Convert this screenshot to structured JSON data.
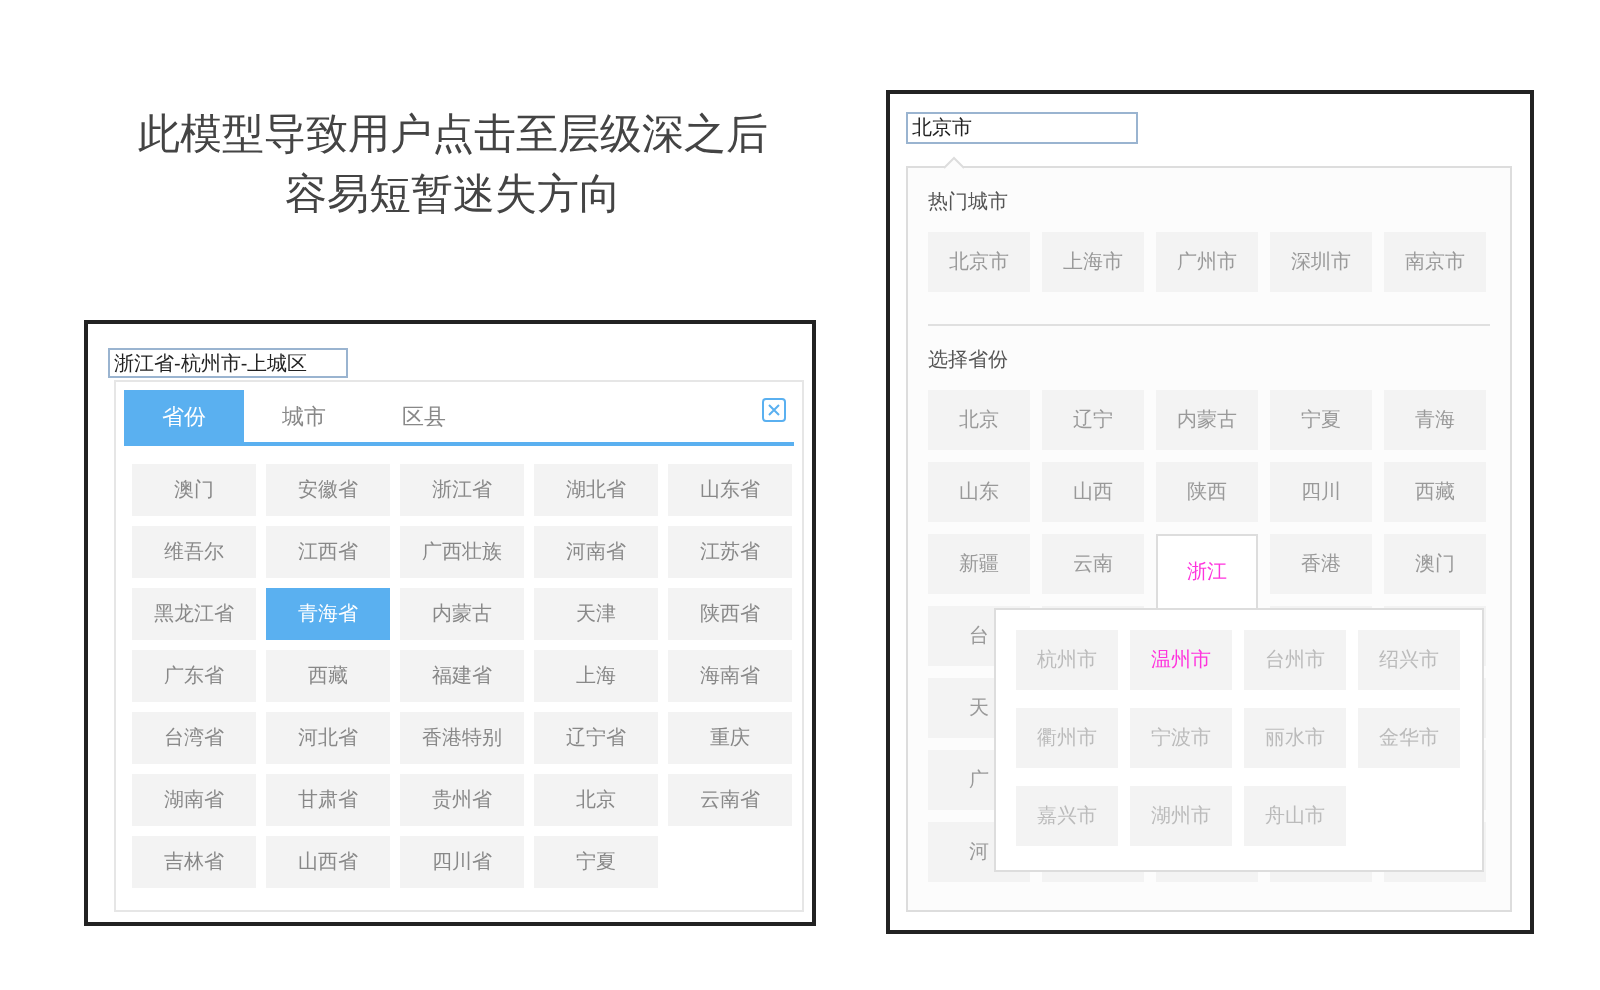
{
  "headline": "此模型导致用户点击至层级深之后容易短暂迷失方向",
  "left_picker": {
    "value": "浙江省-杭州市-上城区",
    "tabs": [
      {
        "label": "省份",
        "selected": true
      },
      {
        "label": "城市",
        "selected": false
      },
      {
        "label": "区县",
        "selected": false
      }
    ],
    "provinces": [
      {
        "label": "澳门",
        "selected": false
      },
      {
        "label": "安徽省",
        "selected": false
      },
      {
        "label": "浙江省",
        "selected": false
      },
      {
        "label": "湖北省",
        "selected": false
      },
      {
        "label": "山东省",
        "selected": false
      },
      {
        "label": "维吾尔",
        "selected": false
      },
      {
        "label": "江西省",
        "selected": false
      },
      {
        "label": "广西壮族",
        "selected": false
      },
      {
        "label": "河南省",
        "selected": false
      },
      {
        "label": "江苏省",
        "selected": false
      },
      {
        "label": "黑龙江省",
        "selected": false
      },
      {
        "label": "青海省",
        "selected": true
      },
      {
        "label": "内蒙古",
        "selected": false
      },
      {
        "label": "天津",
        "selected": false
      },
      {
        "label": "陕西省",
        "selected": false
      },
      {
        "label": "广东省",
        "selected": false
      },
      {
        "label": "西藏",
        "selected": false
      },
      {
        "label": "福建省",
        "selected": false
      },
      {
        "label": "上海",
        "selected": false
      },
      {
        "label": "海南省",
        "selected": false
      },
      {
        "label": "台湾省",
        "selected": false
      },
      {
        "label": "河北省",
        "selected": false
      },
      {
        "label": "香港特别",
        "selected": false
      },
      {
        "label": "辽宁省",
        "selected": false
      },
      {
        "label": "重庆",
        "selected": false
      },
      {
        "label": "湖南省",
        "selected": false
      },
      {
        "label": "甘肃省",
        "selected": false
      },
      {
        "label": "贵州省",
        "selected": false
      },
      {
        "label": "北京",
        "selected": false
      },
      {
        "label": "云南省",
        "selected": false
      },
      {
        "label": "吉林省",
        "selected": false
      },
      {
        "label": "山西省",
        "selected": false
      },
      {
        "label": "四川省",
        "selected": false
      },
      {
        "label": "宁夏",
        "selected": false
      }
    ]
  },
  "right_picker": {
    "value": "北京市",
    "hot_cities": {
      "heading": "热门城市",
      "items": [
        "北京市",
        "上海市",
        "广州市",
        "深圳市",
        "南京市"
      ]
    },
    "provinces": {
      "heading": "选择省份",
      "items": [
        {
          "label": "北京",
          "selected": false
        },
        {
          "label": "辽宁",
          "selected": false
        },
        {
          "label": "内蒙古",
          "selected": false
        },
        {
          "label": "宁夏",
          "selected": false
        },
        {
          "label": "青海",
          "selected": false
        },
        {
          "label": "山东",
          "selected": false
        },
        {
          "label": "山西",
          "selected": false
        },
        {
          "label": "陕西",
          "selected": false
        },
        {
          "label": "四川",
          "selected": false
        },
        {
          "label": "西藏",
          "selected": false
        },
        {
          "label": "新疆",
          "selected": false
        },
        {
          "label": "云南",
          "selected": false
        },
        {
          "label": "浙江",
          "selected": true
        },
        {
          "label": "香港",
          "selected": false
        },
        {
          "label": "澳门",
          "selected": false
        },
        {
          "label": "台",
          "selected": false
        },
        {
          "label": "天",
          "selected": false
        },
        {
          "label": "广",
          "selected": false
        },
        {
          "label": "河",
          "selected": false
        }
      ]
    },
    "cities_popup": {
      "items": [
        {
          "label": "杭州市",
          "selected": false
        },
        {
          "label": "温州市",
          "selected": true
        },
        {
          "label": "台州市",
          "selected": false
        },
        {
          "label": "绍兴市",
          "selected": false
        },
        {
          "label": "衢州市",
          "selected": false
        },
        {
          "label": "宁波市",
          "selected": false
        },
        {
          "label": "丽水市",
          "selected": false
        },
        {
          "label": "金华市",
          "selected": false
        },
        {
          "label": "嘉兴市",
          "selected": false
        },
        {
          "label": "湖州市",
          "selected": false
        },
        {
          "label": "舟山市",
          "selected": false
        }
      ]
    }
  }
}
